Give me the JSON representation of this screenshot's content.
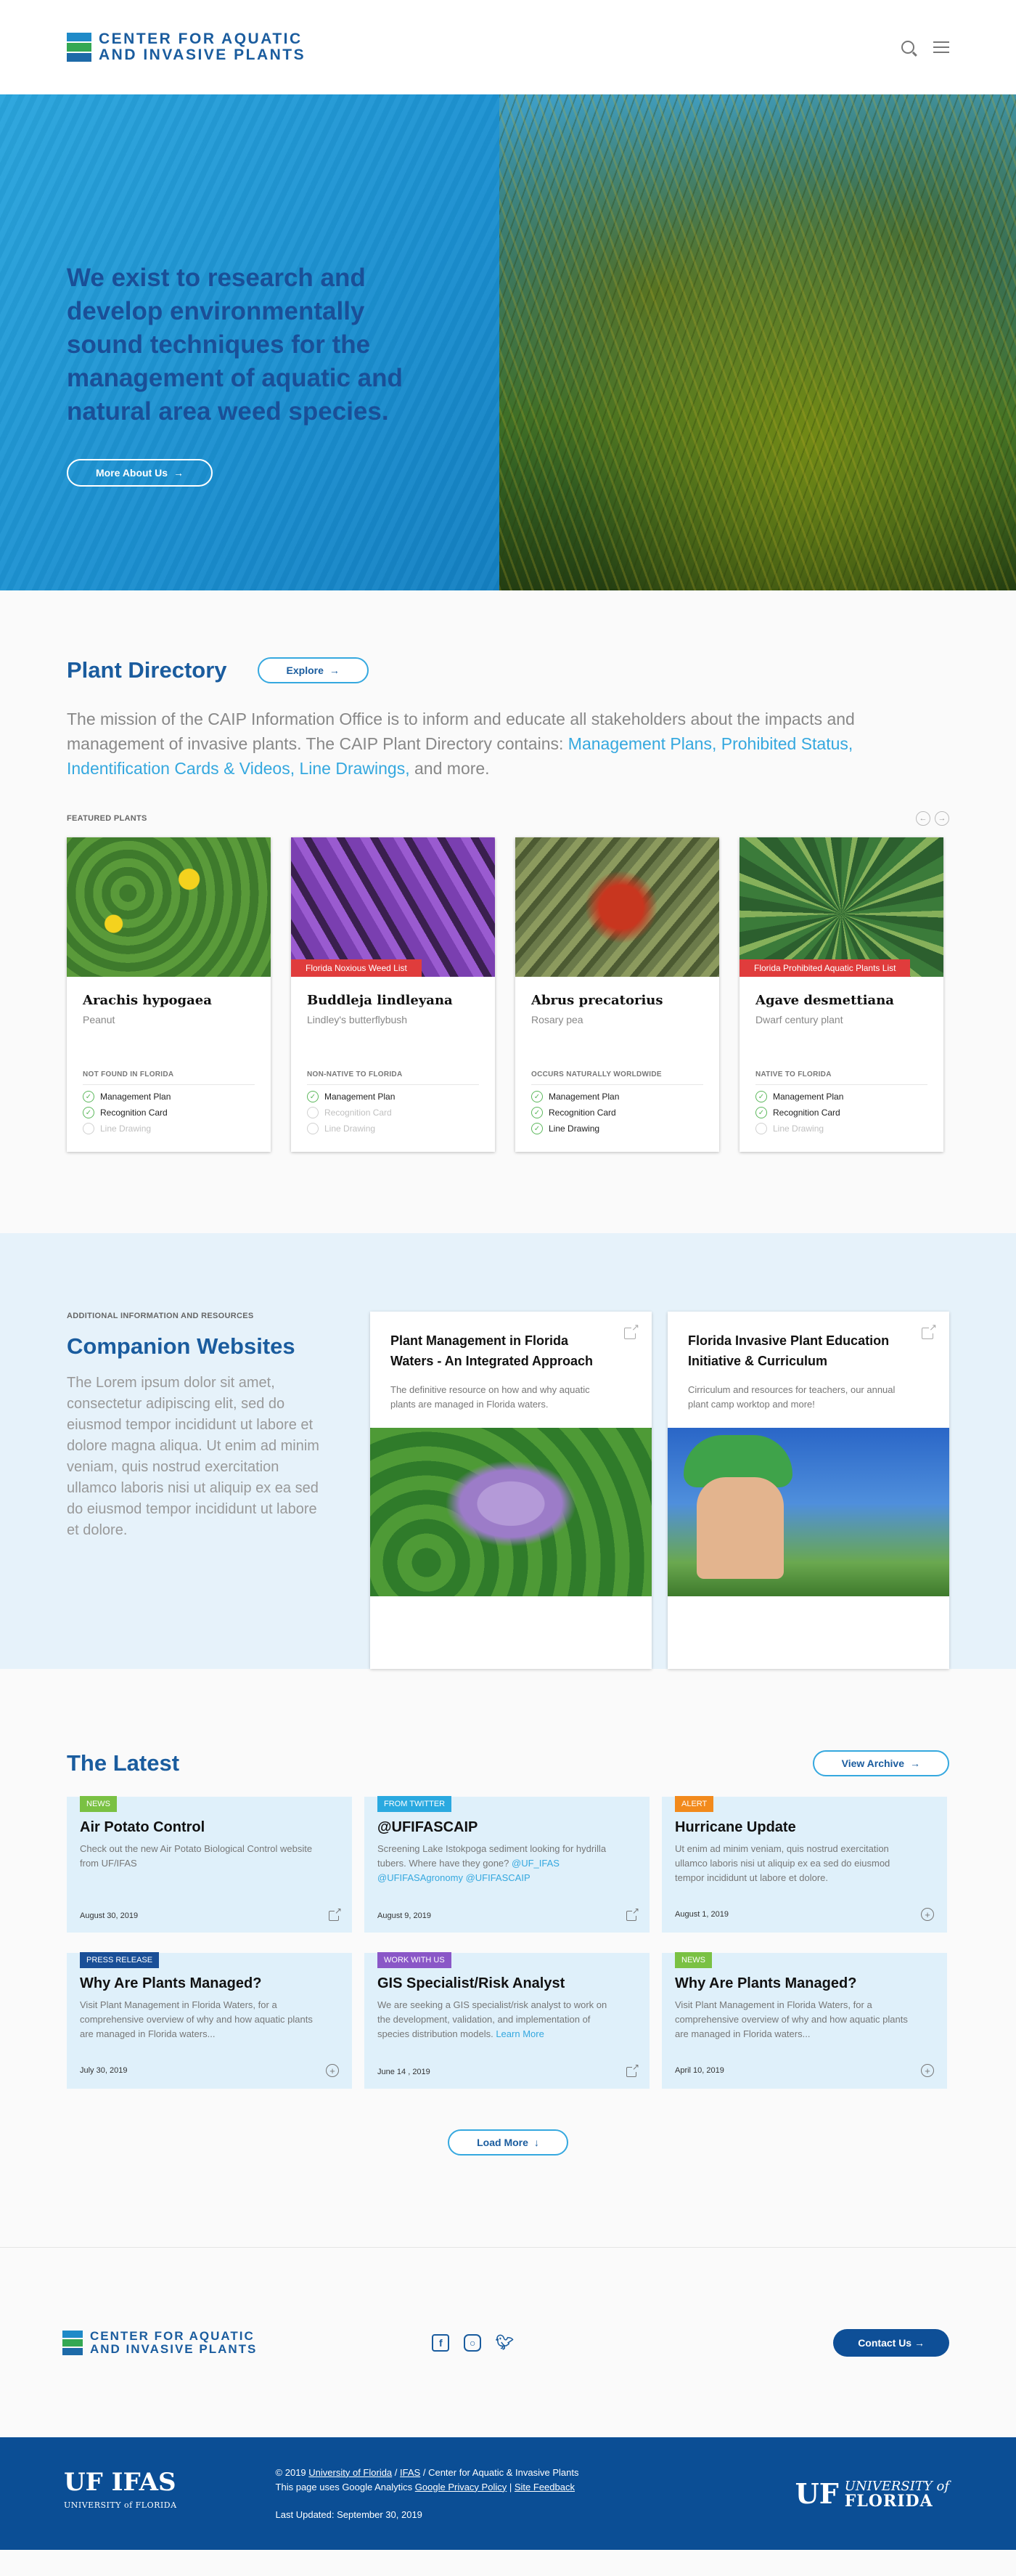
{
  "header": {
    "logo_line1": "CENTER FOR AQUATIC",
    "logo_line2": "AND INVASIVE PLANTS",
    "icons": [
      "search-icon",
      "menu-icon"
    ]
  },
  "hero": {
    "headline": "We exist to research and develop environmentally sound techniques for the management of aquatic and natural area weed species.",
    "button_label": "More About Us"
  },
  "directory": {
    "title": "Plant Directory",
    "explore_label": "Explore",
    "desc_intro": "The mission of the CAIP Information Office is to inform and educate all stakeholders about the impacts and management of invasive plants. The CAIP Plant Directory contains:",
    "desc_links": "Management Plans, Prohibited Status, Indentification Cards & Videos, Line Drawings,",
    "desc_end": "and more.",
    "featured_label": "FEATURED PLANTS",
    "check_labels": [
      "Management Plan",
      "Recognition Card",
      "Line Drawing"
    ],
    "cards": [
      {
        "scientific": "Arachis hypogaea",
        "common": "Peanut",
        "ribbon": "",
        "status": "NOT FOUND IN FLORIDA",
        "checks": [
          true,
          true,
          false
        ]
      },
      {
        "scientific": "Buddleja lindleyana",
        "common": "Lindley's butterflybush",
        "ribbon": "Florida Noxious Weed List",
        "status": "NON-NATIVE TO FLORIDA",
        "checks": [
          true,
          false,
          false
        ]
      },
      {
        "scientific": "Abrus precatorius",
        "common": "Rosary pea",
        "ribbon": "",
        "status": "OCCURS NATURALLY WORLDWIDE",
        "checks": [
          true,
          true,
          true
        ]
      },
      {
        "scientific": "Agave desmettiana",
        "common": "Dwarf century plant",
        "ribbon": "Florida Prohibited Aquatic Plants List",
        "status": "NATIVE TO FLORIDA",
        "checks": [
          true,
          true,
          false
        ]
      }
    ]
  },
  "companion": {
    "kicker": "ADDITIONAL INFORMATION AND RESOURCES",
    "title": "Companion Websites",
    "desc": "The Lorem ipsum dolor sit amet, consectetur adipiscing elit, sed do eiusmod tempor incididunt ut labore et dolore magna aliqua. Ut enim ad minim veniam, quis nostrud exercitation ullamco laboris nisi ut aliquip ex ea sed do eiusmod tempor incididunt ut labore et dolore.",
    "sites": [
      {
        "title": "Plant Management in Florida Waters - An Integrated Approach",
        "desc": "The definitive resource on how and why aquatic plants are managed in Florida waters."
      },
      {
        "title": "Florida Invasive Plant Education Initiative & Curriculum",
        "desc": "Cirriculum and resources for teachers, our annual plant camp worktop and more!"
      }
    ]
  },
  "latest": {
    "title": "The Latest",
    "archive_label": "View Archive",
    "load_more_label": "Load More",
    "items": [
      {
        "tag": "NEWS",
        "title": "Air Potato Control",
        "body": "Check out the new Air Potato Biological Control website from UF/IFAS",
        "link": "",
        "date": "August 30, 2019",
        "action": "external"
      },
      {
        "tag": "FROM TWITTER",
        "title": "@UFIFASCAIP",
        "body": "Screening Lake Istokpoga sediment looking for hydrilla tubers. Where have they gone?",
        "link": "@UF_IFAS @UFIFASAgronomy @UFIFASCAIP",
        "date": "August 9, 2019",
        "action": "external"
      },
      {
        "tag": "ALERT",
        "title": "Hurricane Update",
        "body": "Ut enim ad minim veniam, quis nostrud exercitation ullamco laboris nisi ut aliquip ex ea sed do eiusmod tempor incididunt ut labore et dolore.",
        "link": "",
        "date": "August 1, 2019",
        "action": "expand"
      },
      {
        "tag": "PRESS RELEASE",
        "title": "Why Are Plants Managed?",
        "body": "Visit Plant Management in Florida Waters, for a comprehensive overview of why and how aquatic plants are managed in Florida waters...",
        "link": "",
        "date": "July 30, 2019",
        "action": "expand"
      },
      {
        "tag": "WORK WITH US",
        "title": "GIS Specialist/Risk Analyst",
        "body": "We are seeking a GIS specialist/risk analyst to work on the development, validation, and implementation of species distribution models.",
        "link": "Learn More",
        "date": "June 14 , 2019",
        "action": "external"
      },
      {
        "tag": "NEWS",
        "title": "Why Are Plants Managed?",
        "body": "Visit Plant Management in Florida Waters, for a comprehensive overview of why and how aquatic plants are managed in Florida waters...",
        "link": "",
        "date": "April 10, 2019",
        "action": "expand"
      }
    ]
  },
  "footer": {
    "logo_line1": "CENTER FOR AQUATIC",
    "logo_line2": "AND INVASIVE PLANTS",
    "contact_label": "Contact Us",
    "ifas_main": "UF IFAS",
    "ifas_sub": "UNIVERSITY of FLORIDA",
    "copy_prefix": "© 2019",
    "copy_uf": "University of Florida",
    "copy_sep": "/",
    "copy_ifas": "IFAS",
    "copy_suffix": "/ Center for Aquatic & Invasive Plants",
    "analytics_prefix": "This page uses Google Analytics",
    "privacy_link": "Google Privacy Policy",
    "pipe": "|",
    "feedback_link": "Site Feedback",
    "updated": "Last Updated: September 30, 2019",
    "uf_mark": "UF",
    "uf_word_top": "UNIVERSITY of",
    "uf_word_bottom": "FLORIDA"
  }
}
